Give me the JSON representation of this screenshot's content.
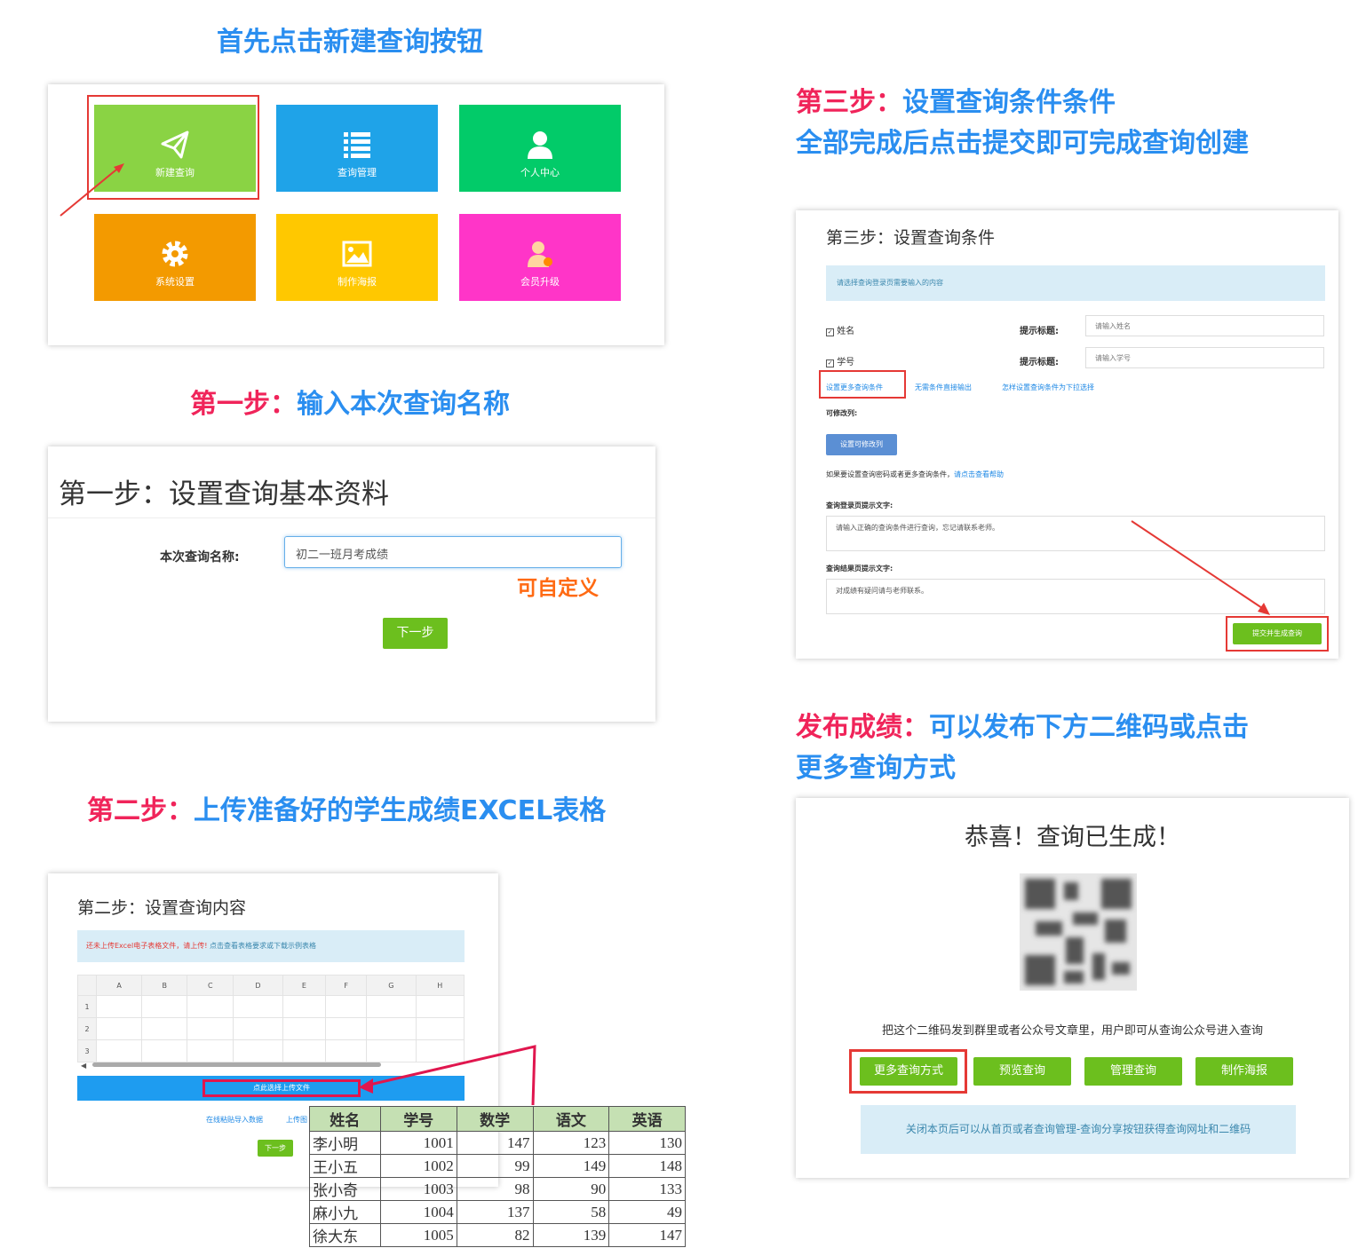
{
  "intro_heading": "首先点击新建查询按钮",
  "tiles": [
    {
      "label": "新建查询",
      "color": "#8ad344",
      "icon": "paper-plane-icon"
    },
    {
      "label": "查询管理",
      "color": "#1fa3e8",
      "icon": "list-icon"
    },
    {
      "label": "个人中心",
      "color": "#02cb69",
      "icon": "user-icon"
    },
    {
      "label": "系统设置",
      "color": "#f39a00",
      "icon": "gear-icon"
    },
    {
      "label": "制作海报",
      "color": "#ffc800",
      "icon": "image-icon"
    },
    {
      "label": "会员升级",
      "color": "#ff35c8",
      "icon": "member-icon"
    }
  ],
  "step1": {
    "heading_prefix": "第一步：",
    "heading_rest": "输入本次查询名称",
    "panel_title": "第一步：设置查询基本资料",
    "field_label": "本次查询名称:",
    "field_value": "初二一班月考成绩",
    "annotation": "可自定义",
    "next_button": "下一步"
  },
  "step2": {
    "heading_prefix": "第二步：",
    "heading_rest": "上传准备好的学生成绩EXCEL表格",
    "panel_title": "第二步：设置查询内容",
    "alert_red": "还未上传Excel电子表格文件，请上传!",
    "alert_link": "点击查看表格要求或下载示例表格",
    "columns": [
      "A",
      "B",
      "C",
      "D",
      "E",
      "F",
      "G",
      "H"
    ],
    "rows": [
      "1",
      "2",
      "3"
    ],
    "upload_button": "点此选择上传文件",
    "link1": "在线粘贴导入数据",
    "link2": "上传图",
    "next_button": "下一步",
    "grade_table": {
      "headers": [
        "姓名",
        "学号",
        "数学",
        "语文",
        "英语"
      ],
      "rows": [
        [
          "李小明",
          "1001",
          "147",
          "123",
          "130"
        ],
        [
          "王小五",
          "1002",
          "99",
          "149",
          "148"
        ],
        [
          "张小奇",
          "1003",
          "98",
          "90",
          "133"
        ],
        [
          "麻小九",
          "1004",
          "137",
          "58",
          "49"
        ],
        [
          "徐大东",
          "1005",
          "82",
          "139",
          "147"
        ]
      ]
    }
  },
  "step3": {
    "heading_prefix": "第三步：",
    "heading_rest": "设置查询条件条件",
    "heading_line2": "全部完成后点击提交即可完成查询创建",
    "panel_title": "第三步：设置查询条件",
    "info": "请选择查询登录页需要输入的内容",
    "cond1_label": "姓名",
    "cond2_label": "学号",
    "hint_label": "提示标题:",
    "cond1_placeholder": "请输入姓名",
    "cond2_placeholder": "请输入学号",
    "link_more": "设置更多查询条件",
    "link_no_cond": "无需条件直接输出",
    "link_dropdown": "怎样设置查询条件为下拉选择",
    "editable_label": "可修改列:",
    "editable_button": "设置可修改列",
    "help_text": "如果要设置查询密码或者更多查询条件，",
    "help_link": "请点击查看帮助",
    "login_tip_label": "查询登录页提示文字:",
    "login_tip_value": "请输入正确的查询条件进行查询，忘记请联系老师。",
    "result_tip_label": "查询结果页提示文字:",
    "result_tip_value": "对成绩有疑问请与老师联系。",
    "submit_button": "提交并生成查询"
  },
  "publish": {
    "heading_prefix": "发布成绩：",
    "heading_rest": "可以发布下方二维码或点击",
    "heading_line2": "更多查询方式",
    "panel_title": "恭喜！查询已生成！",
    "qr_caption": "把这个二维码发到群里或者公众号文章里，用户即可从查询公众号进入查询",
    "buttons": [
      "更多查询方式",
      "预览查询",
      "管理查询",
      "制作海报"
    ],
    "note": "关闭本页后可以从首页或者查询管理-查询分享按钮获得查询网址和二维码"
  }
}
